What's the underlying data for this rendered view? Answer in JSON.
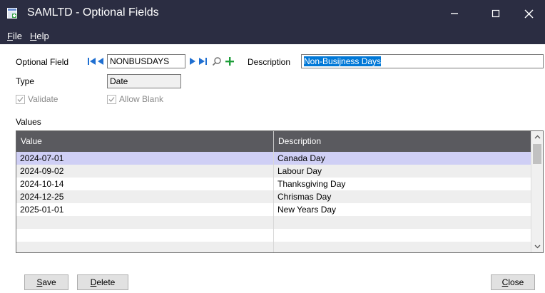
{
  "window": {
    "title": "SAMLTD - Optional Fields",
    "minimize_glyph": "—",
    "maximize_glyph": "☐",
    "close_glyph": "✕"
  },
  "menu": {
    "file": {
      "accel": "F",
      "rest": "ile"
    },
    "help": {
      "accel": "H",
      "rest": "elp"
    }
  },
  "form": {
    "optional_field_label": "Optional Field",
    "optional_field_value": "NONBUSDAYS",
    "description_label": "Description",
    "description_value": "Non-Busijness Days",
    "type_label": "Type",
    "type_value": "Date",
    "validate_label": "Validate",
    "validate_checked": true,
    "allow_blank_label": "Allow Blank",
    "allow_blank_checked": true,
    "values_label": "Values"
  },
  "icons": {
    "first": "first-record-icon",
    "prev": "previous-record-icon",
    "next": "next-record-icon",
    "last": "last-record-icon",
    "finder": "finder-search-icon",
    "add": "add-new-icon",
    "accent_blue": "#1f6fd1",
    "accent_green": "#1e9e3a"
  },
  "grid": {
    "columns": [
      "Value",
      "Description"
    ],
    "rows": [
      {
        "value": "2024-07-01",
        "description": "Canada Day",
        "selected": true
      },
      {
        "value": "2024-09-02",
        "description": "Labour Day"
      },
      {
        "value": "2024-10-14",
        "description": "Thanksgiving Day"
      },
      {
        "value": "2024-12-25",
        "description": "Chrismas Day"
      },
      {
        "value": "2025-01-01",
        "description": "New Years Day"
      },
      {
        "value": "",
        "description": ""
      },
      {
        "value": "",
        "description": ""
      },
      {
        "value": "",
        "description": ""
      }
    ]
  },
  "buttons": {
    "save": {
      "accel": "S",
      "rest": "ave"
    },
    "delete": {
      "accel": "D",
      "rest": "elete"
    },
    "close": {
      "accel": "C",
      "rest": "lose"
    }
  }
}
